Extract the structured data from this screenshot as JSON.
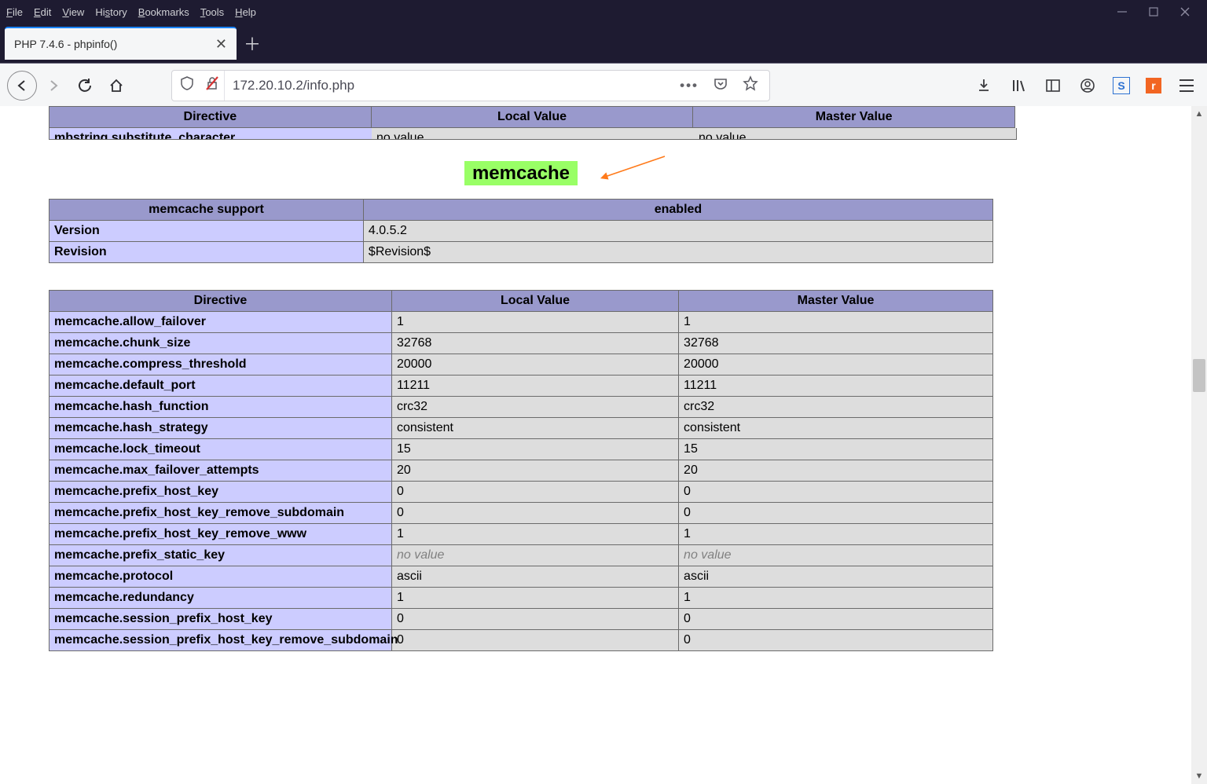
{
  "window": {
    "menu": [
      "File",
      "Edit",
      "View",
      "History",
      "Bookmarks",
      "Tools",
      "Help"
    ],
    "tab_title": "PHP 7.4.6 - phpinfo()",
    "url": "172.20.10.2/info.php"
  },
  "sticky_header": {
    "cols": [
      "Directive",
      "Local Value",
      "Master Value"
    ]
  },
  "clipped_row": {
    "directive": "mbstring.substitute_character",
    "local": "no value",
    "master": "no value"
  },
  "section_title": "memcache",
  "support_table": {
    "header": [
      "memcache support",
      "enabled"
    ],
    "rows": [
      {
        "k": "Version",
        "v": "4.0.5.2"
      },
      {
        "k": "Revision",
        "v": "$Revision$"
      }
    ]
  },
  "directives_header": [
    "Directive",
    "Local Value",
    "Master Value"
  ],
  "no_value_text": "no value",
  "directives": [
    {
      "d": "memcache.allow_failover",
      "l": "1",
      "m": "1"
    },
    {
      "d": "memcache.chunk_size",
      "l": "32768",
      "m": "32768"
    },
    {
      "d": "memcache.compress_threshold",
      "l": "20000",
      "m": "20000"
    },
    {
      "d": "memcache.default_port",
      "l": "11211",
      "m": "11211"
    },
    {
      "d": "memcache.hash_function",
      "l": "crc32",
      "m": "crc32"
    },
    {
      "d": "memcache.hash_strategy",
      "l": "consistent",
      "m": "consistent"
    },
    {
      "d": "memcache.lock_timeout",
      "l": "15",
      "m": "15"
    },
    {
      "d": "memcache.max_failover_attempts",
      "l": "20",
      "m": "20"
    },
    {
      "d": "memcache.prefix_host_key",
      "l": "0",
      "m": "0"
    },
    {
      "d": "memcache.prefix_host_key_remove_subdomain",
      "l": "0",
      "m": "0"
    },
    {
      "d": "memcache.prefix_host_key_remove_www",
      "l": "1",
      "m": "1"
    },
    {
      "d": "memcache.prefix_static_key",
      "l": "no value",
      "m": "no value",
      "nv": true
    },
    {
      "d": "memcache.protocol",
      "l": "ascii",
      "m": "ascii"
    },
    {
      "d": "memcache.redundancy",
      "l": "1",
      "m": "1"
    },
    {
      "d": "memcache.session_prefix_host_key",
      "l": "0",
      "m": "0"
    },
    {
      "d": "memcache.session_prefix_host_key_remove_subdomain",
      "l": "0",
      "m": "0"
    }
  ]
}
